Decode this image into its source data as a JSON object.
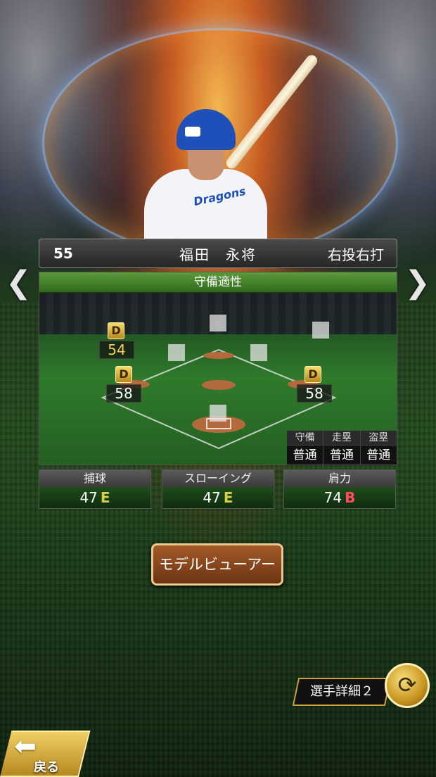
{
  "player": {
    "number": "55",
    "name": "福田　永将",
    "handedness": "右投右打"
  },
  "field": {
    "title": "守備適性",
    "positions": [
      {
        "id": "lf",
        "rank": "D",
        "value": "54"
      },
      {
        "id": "first-base",
        "rank": "D",
        "value": "58"
      },
      {
        "id": "third-base",
        "rank": "D",
        "value": "58"
      }
    ],
    "mini_stats": {
      "headers": [
        "守備",
        "走塁",
        "盗塁"
      ],
      "values": [
        "普通",
        "普通",
        "普通"
      ]
    }
  },
  "stats": [
    {
      "label": "捕球",
      "value": "47",
      "grade": "E"
    },
    {
      "label": "スローイング",
      "value": "47",
      "grade": "E"
    },
    {
      "label": "肩力",
      "value": "74",
      "grade": "B"
    }
  ],
  "buttons": {
    "model_viewer": "モデルビューアー",
    "player_detail": "選手詳細２",
    "back": "戻る"
  },
  "icons": {
    "prev": "chevron-left-icon",
    "next": "chevron-right-icon",
    "swap": "swap-arrows-icon",
    "back": "back-arrow-icon"
  }
}
